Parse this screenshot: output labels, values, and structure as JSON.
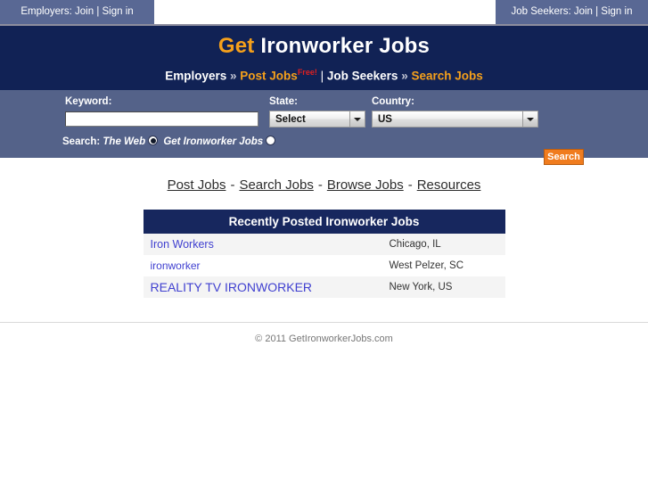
{
  "topbar": {
    "employers_tab": "Employers: Join | Sign in",
    "jobseekers_tab": "Job Seekers: Join | Sign in"
  },
  "masthead": {
    "brand_get": "Get",
    "brand_rest": "Ironworker Jobs",
    "subnav": {
      "employers": "Employers",
      "chevron1": "»",
      "post_jobs": "Post Jobs",
      "free_badge": "Free!",
      "pipe": "|",
      "job_seekers": "Job Seekers",
      "chevron2": "»",
      "search_jobs": "Search Jobs"
    },
    "colors": {
      "background": "#112255",
      "accent_orange": "#F5A01B",
      "free_red": "#e02020"
    }
  },
  "search": {
    "keyword_label": "Keyword:",
    "keyword_value": "",
    "keyword_placeholder": "",
    "state_label": "State:",
    "state_value": "Select",
    "country_label": "Country:",
    "country_value": "US",
    "search_button": "Search",
    "scope_label": "Search:",
    "scope_web": "The Web",
    "scope_site": "Get Ironworker Jobs",
    "scope_selected": "The Web",
    "panel_color": "#546289",
    "button_color": "#F07C1E"
  },
  "mainnav": {
    "separator": "-",
    "items": [
      {
        "label": "Post Jobs"
      },
      {
        "label": "Search Jobs"
      },
      {
        "label": "Browse Jobs"
      },
      {
        "label": "Resources"
      }
    ]
  },
  "jobs": {
    "heading": "Recently Posted Ironworker Jobs",
    "rows": [
      {
        "title": "Iron Workers",
        "location": "Chicago, IL"
      },
      {
        "title": "ironworker",
        "location": "West Pelzer, SC"
      },
      {
        "title": "REALITY TV IRONWORKER",
        "location": "New York, US"
      }
    ]
  },
  "footer": {
    "copyright": "© 2011 GetIronworkerJobs.com"
  }
}
